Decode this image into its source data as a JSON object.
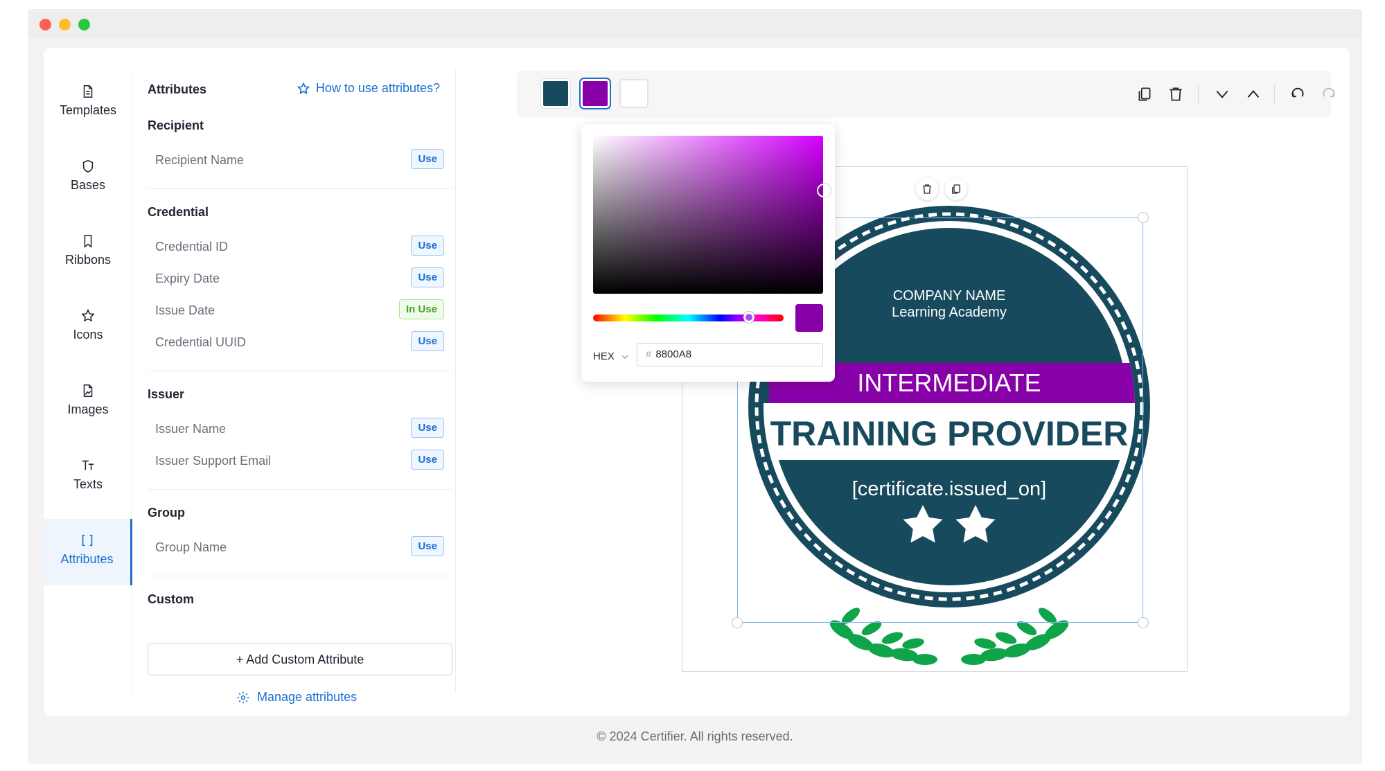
{
  "nav": {
    "items": [
      {
        "label": "Templates",
        "icon": "document-icon"
      },
      {
        "label": "Bases",
        "icon": "shield-icon"
      },
      {
        "label": "Ribbons",
        "icon": "bookmark-icon"
      },
      {
        "label": "Icons",
        "icon": "star-icon"
      },
      {
        "label": "Images",
        "icon": "image-file-icon"
      },
      {
        "label": "Texts",
        "icon": "text-icon"
      },
      {
        "label": "Attributes",
        "icon": "brackets-icon",
        "active": true
      }
    ]
  },
  "panel": {
    "title": "Attributes",
    "help_link": "How to use attributes?",
    "sections": {
      "recipient": {
        "title": "Recipient",
        "items": [
          {
            "name": "Recipient Name",
            "status": "Use"
          }
        ]
      },
      "credential": {
        "title": "Credential",
        "items": [
          {
            "name": "Credential ID",
            "status": "Use"
          },
          {
            "name": "Expiry Date",
            "status": "Use"
          },
          {
            "name": "Issue Date",
            "status": "In Use"
          },
          {
            "name": "Credential UUID",
            "status": "Use"
          }
        ]
      },
      "issuer": {
        "title": "Issuer",
        "items": [
          {
            "name": "Issuer Name",
            "status": "Use"
          },
          {
            "name": "Issuer Support Email",
            "status": "Use"
          }
        ]
      },
      "group": {
        "title": "Group",
        "items": [
          {
            "name": "Group Name",
            "status": "Use"
          }
        ]
      },
      "custom": {
        "title": "Custom"
      }
    },
    "add_custom_label": "+ Add Custom Attribute",
    "manage_label": "Manage attributes"
  },
  "toolbar": {
    "swatches": [
      "#184A5D",
      "#8800A8",
      "#FFFFFF"
    ],
    "actions": [
      "copy-icon",
      "trash-icon",
      "chevron-down-icon",
      "chevron-up-icon",
      "undo-icon",
      "redo-icon"
    ]
  },
  "color_picker": {
    "mode": "HEX",
    "hex_value": "8800A8",
    "hash": "#"
  },
  "badge": {
    "company": "COMPANY NAME",
    "academy": "Learning Academy",
    "ribbon": "INTERMEDIATE",
    "title": "TRAINING PROVIDER",
    "attribute": "[certificate.issued_on]",
    "stars": 2,
    "colors": {
      "base": "#184A5D",
      "ribbon": "#8800A8",
      "laurel": "#0FA34A"
    }
  },
  "footer": {
    "text": "© 2024 Certifier. All rights reserved."
  }
}
